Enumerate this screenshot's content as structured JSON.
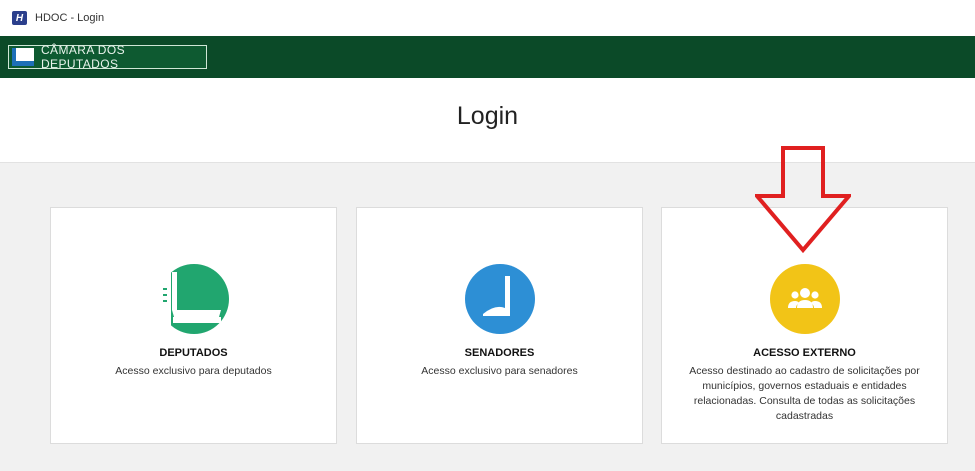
{
  "window": {
    "title": "HDOC - Login",
    "app_icon": "H"
  },
  "banner": {
    "text": "CÂMARA DOS DEPUTADOS",
    "color": "#0b4a28"
  },
  "page": {
    "title": "Login"
  },
  "cards": [
    {
      "title": "DEPUTADOS",
      "description": "Acesso exclusivo para deputados",
      "icon": "camara-logo-icon",
      "color": "#21a66f"
    },
    {
      "title": "SENADORES",
      "description": "Acesso exclusivo para senadores",
      "icon": "senado-logo-icon",
      "color": "#2d8fd5"
    },
    {
      "title": "ACESSO EXTERNO",
      "description": "Acesso destinado ao cadastro de solicitações por municípios, governos estaduais e entidades relacionadas. Consulta de todas as solicitações cadastradas",
      "icon": "users-group-icon",
      "color": "#f2c417"
    }
  ],
  "annotation": {
    "icon": "down-arrow-icon",
    "color": "#e02020"
  }
}
